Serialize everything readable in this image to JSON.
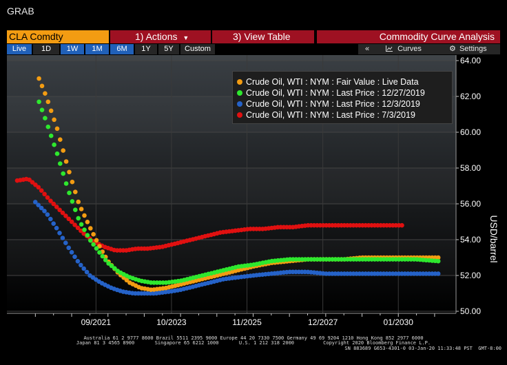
{
  "app": {
    "grab_label": "GRAB"
  },
  "toolbar": {
    "ticker": "CLA Comdty",
    "actions_label": "Actions",
    "actions_num": "1)",
    "view_table_num": "3)",
    "view_table_label": "View Table",
    "title": "Commodity Curve Analysis"
  },
  "timeframes": [
    "Live",
    "1D",
    "1W",
    "1M",
    "6M",
    "1Y",
    "5Y",
    "Custom"
  ],
  "right_controls": {
    "collapse": "«",
    "curves_label": "Curves",
    "settings_label": "Settings"
  },
  "colors": {
    "orange": "#f39c12",
    "green": "#2ee82e",
    "blue": "#2562c8",
    "red": "#e01010",
    "brand_red": "#9e1122",
    "timeframe_blue": "#2060b8"
  },
  "legend": [
    {
      "label": "Crude Oil, WTI : NYM : Fair Value : Live Data",
      "color": "#f39c12"
    },
    {
      "label": "Crude Oil, WTI : NYM : Last Price : 12/27/2019",
      "color": "#2ee82e"
    },
    {
      "label": "Crude Oil, WTI : NYM : Last Price : 12/3/2019",
      "color": "#2562c8"
    },
    {
      "label": "Crude Oil, WTI : NYM : Last Price : 7/3/2019",
      "color": "#e01010"
    }
  ],
  "chart_data": {
    "type": "scatter",
    "ylabel": "USD/barrel",
    "ylim": [
      50,
      64
    ],
    "xlim": [
      2019.5,
      2031.4
    ],
    "y_ticks": [
      "50.00",
      "52.00",
      "54.00",
      "56.00",
      "58.00",
      "60.00",
      "62.00",
      "64.00"
    ],
    "x_ticks": [
      {
        "label": "09/2021",
        "value": 2021.67
      },
      {
        "label": "10/2023",
        "value": 2023.75
      },
      {
        "label": "11/2025",
        "value": 2025.83
      },
      {
        "label": "12/2027",
        "value": 2027.92
      },
      {
        "label": "01/2030",
        "value": 2030.0
      }
    ],
    "grid": true,
    "legend_position": "top-right",
    "series": [
      {
        "name": "Crude Oil, WTI : NYM : Fair Value : Live Data",
        "x": [
          2020.1,
          2020.3,
          2020.6,
          2020.9,
          2021.2,
          2021.5,
          2021.8,
          2022.0,
          2022.3,
          2022.6,
          2022.9,
          2023.2,
          2023.6,
          2024.0,
          2024.4,
          2024.8,
          2025.2,
          2025.6,
          2026.0,
          2026.5,
          2027.0,
          2027.5,
          2028.0,
          2028.5,
          2029.0,
          2029.5,
          2030.0,
          2030.5,
          2031.1
        ],
        "y": [
          63.0,
          62.0,
          60.2,
          58.0,
          56.0,
          54.7,
          53.5,
          52.8,
          52.1,
          51.6,
          51.3,
          51.2,
          51.3,
          51.5,
          51.7,
          51.9,
          52.1,
          52.3,
          52.5,
          52.7,
          52.8,
          52.9,
          52.9,
          52.9,
          53.0,
          53.0,
          53.0,
          53.0,
          53.0
        ]
      },
      {
        "name": "Crude Oil, WTI : NYM : Last Price : 12/27/2019",
        "x": [
          2020.1,
          2020.3,
          2020.6,
          2020.9,
          2021.2,
          2021.5,
          2021.8,
          2022.0,
          2022.3,
          2022.6,
          2022.9,
          2023.2,
          2023.6,
          2024.0,
          2024.4,
          2024.8,
          2025.2,
          2025.6,
          2026.0,
          2026.5,
          2027.0,
          2027.5,
          2028.0,
          2028.5,
          2029.0,
          2029.5,
          2030.0,
          2030.5,
          2031.1
        ],
        "y": [
          61.7,
          60.6,
          58.8,
          56.8,
          55.1,
          54.0,
          53.2,
          52.7,
          52.2,
          51.9,
          51.7,
          51.6,
          51.6,
          51.7,
          51.9,
          52.1,
          52.3,
          52.5,
          52.6,
          52.8,
          52.9,
          52.9,
          52.9,
          52.9,
          52.9,
          52.9,
          52.9,
          52.9,
          52.8
        ]
      },
      {
        "name": "Crude Oil, WTI : NYM : Last Price : 12/3/2019",
        "x": [
          2020.0,
          2020.3,
          2020.6,
          2020.9,
          2021.2,
          2021.5,
          2021.8,
          2022.1,
          2022.4,
          2022.7,
          2023.0,
          2023.3,
          2023.7,
          2024.0,
          2024.4,
          2024.8,
          2025.2,
          2025.6,
          2026.0,
          2026.5,
          2027.0,
          2027.5,
          2028.0,
          2028.5,
          2029.0,
          2029.5,
          2030.0,
          2030.5,
          2031.1
        ],
        "y": [
          56.1,
          55.5,
          54.6,
          53.6,
          52.7,
          52.0,
          51.6,
          51.3,
          51.1,
          51.0,
          51.0,
          51.0,
          51.1,
          51.2,
          51.4,
          51.6,
          51.8,
          51.9,
          52.0,
          52.1,
          52.2,
          52.2,
          52.1,
          52.1,
          52.1,
          52.1,
          52.1,
          52.1,
          52.1
        ]
      },
      {
        "name": "Crude Oil, WTI : NYM : Last Price : 7/3/2019",
        "x": [
          2019.5,
          2019.8,
          2020.1,
          2020.4,
          2020.7,
          2021.0,
          2021.3,
          2021.6,
          2021.9,
          2022.2,
          2022.5,
          2022.8,
          2023.1,
          2023.5,
          2023.9,
          2024.3,
          2024.7,
          2025.1,
          2025.5,
          2025.9,
          2026.3,
          2026.7,
          2027.1,
          2027.5,
          2027.9,
          2028.3,
          2028.7,
          2029.1,
          2029.5,
          2029.8,
          2030.1
        ],
        "y": [
          57.3,
          57.4,
          56.9,
          56.2,
          55.6,
          55.0,
          54.4,
          53.9,
          53.6,
          53.4,
          53.4,
          53.5,
          53.5,
          53.6,
          53.8,
          54.0,
          54.2,
          54.4,
          54.5,
          54.6,
          54.6,
          54.7,
          54.7,
          54.8,
          54.8,
          54.8,
          54.8,
          54.8,
          54.8,
          54.8,
          54.8
        ]
      }
    ]
  },
  "footer": {
    "line1": "Australia 61 2 9777 8600 Brazil 5511 2395 9000 Europe 44 20 7330 7500 Germany 49 69 9204 1210 Hong Kong 852 2977 6000",
    "line2": "Japan 81 3 4565 8900       Singapore 65 6212 1000       U.S. 1 212 318 2000          Copyright 2020 Bloomberg Finance L.P.",
    "line3": "SN 883689 G653-4301-0 03-Jan-20 11:33:48 PST  GMT-8:00"
  }
}
